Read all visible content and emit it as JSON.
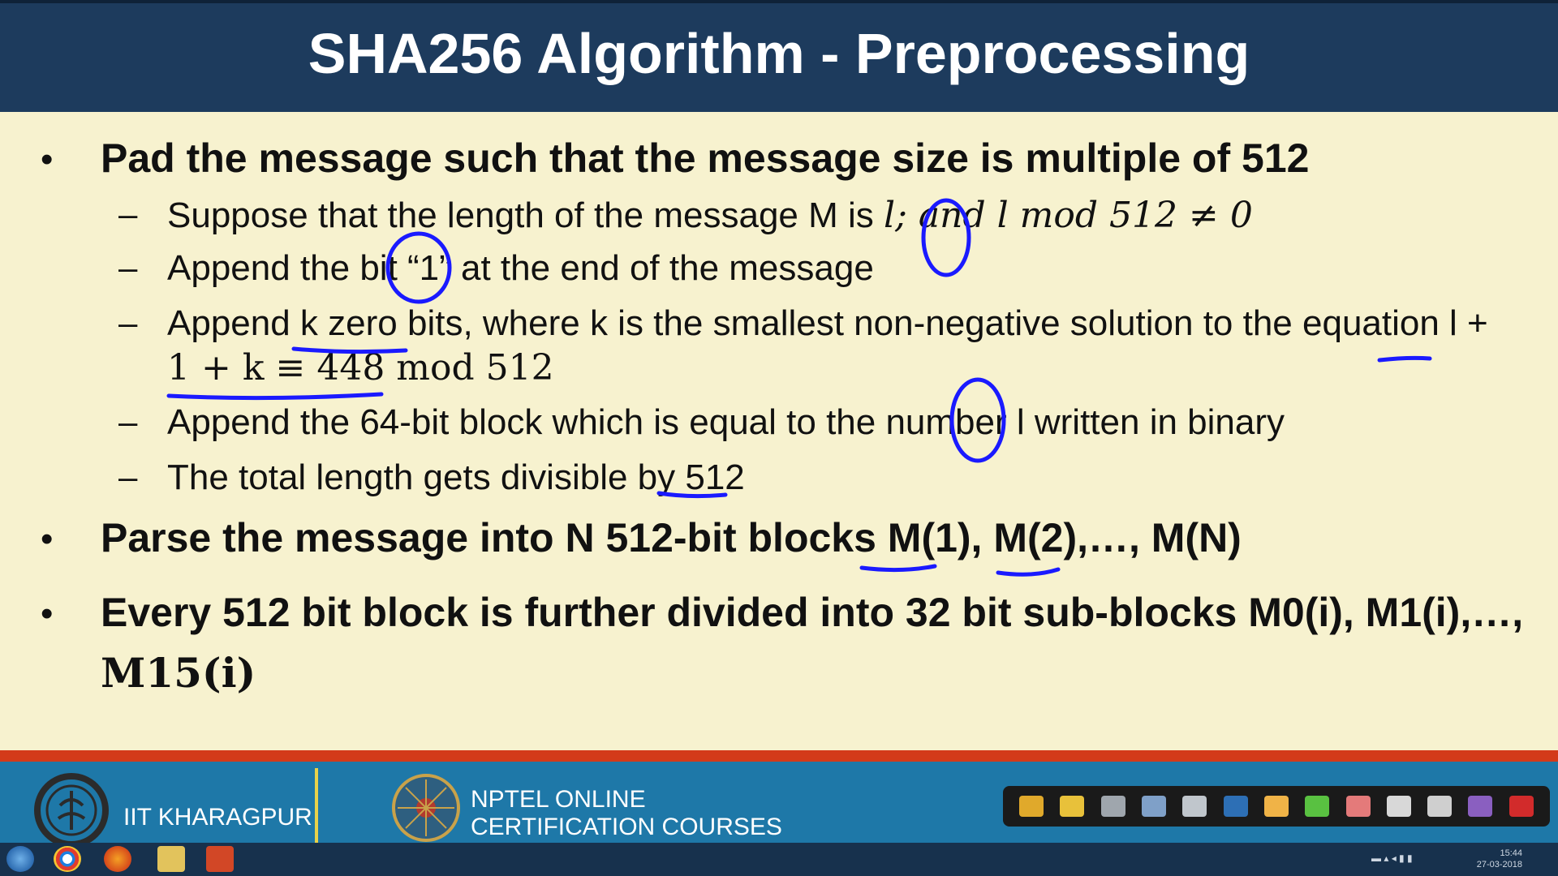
{
  "slide": {
    "title": "SHA256 Algorithm - Preprocessing",
    "bullet1": {
      "text": "Pad the message such that the message size is multiple of 512",
      "subs": [
        {
          "pre": "Suppose that the length of the message M is ",
          "math": "l; and l mod 512 ≠ 0"
        },
        {
          "pre": "Append the bit “1” at the end of the message"
        },
        {
          "line1": "Append k zero bits, where k is the smallest non-negative solution to the equation l +",
          "line2": "1 + k ≡ 448 mod 512"
        },
        {
          "pre": "Append the 64-bit block which is equal to the number l written in binary"
        },
        {
          "pre": "The total length gets divisible by 512"
        }
      ]
    },
    "bullet2": {
      "text": "Parse the message into N 512-bit blocks M(1), M(2),…, M(N)"
    },
    "bullet3": {
      "line1": "Every 512 bit block is further divided into 32 bit sub-blocks M0(i), M1(i),…,",
      "line2": "M15(i)"
    }
  },
  "footer": {
    "iitk_label": "IIT KHARAGPUR",
    "nptel_line1": "NPTEL ONLINE",
    "nptel_line2": "CERTIFICATION COURSES"
  },
  "taskbar": {
    "time": "15:44",
    "date": "27-03-2018"
  },
  "colors": {
    "title_bg": "#1d3b5d",
    "slide_bg": "#f7f2cf",
    "annotation": "#1a1aff",
    "footer_bg": "#1e78a8",
    "footer_accent": "#d33a1a"
  }
}
